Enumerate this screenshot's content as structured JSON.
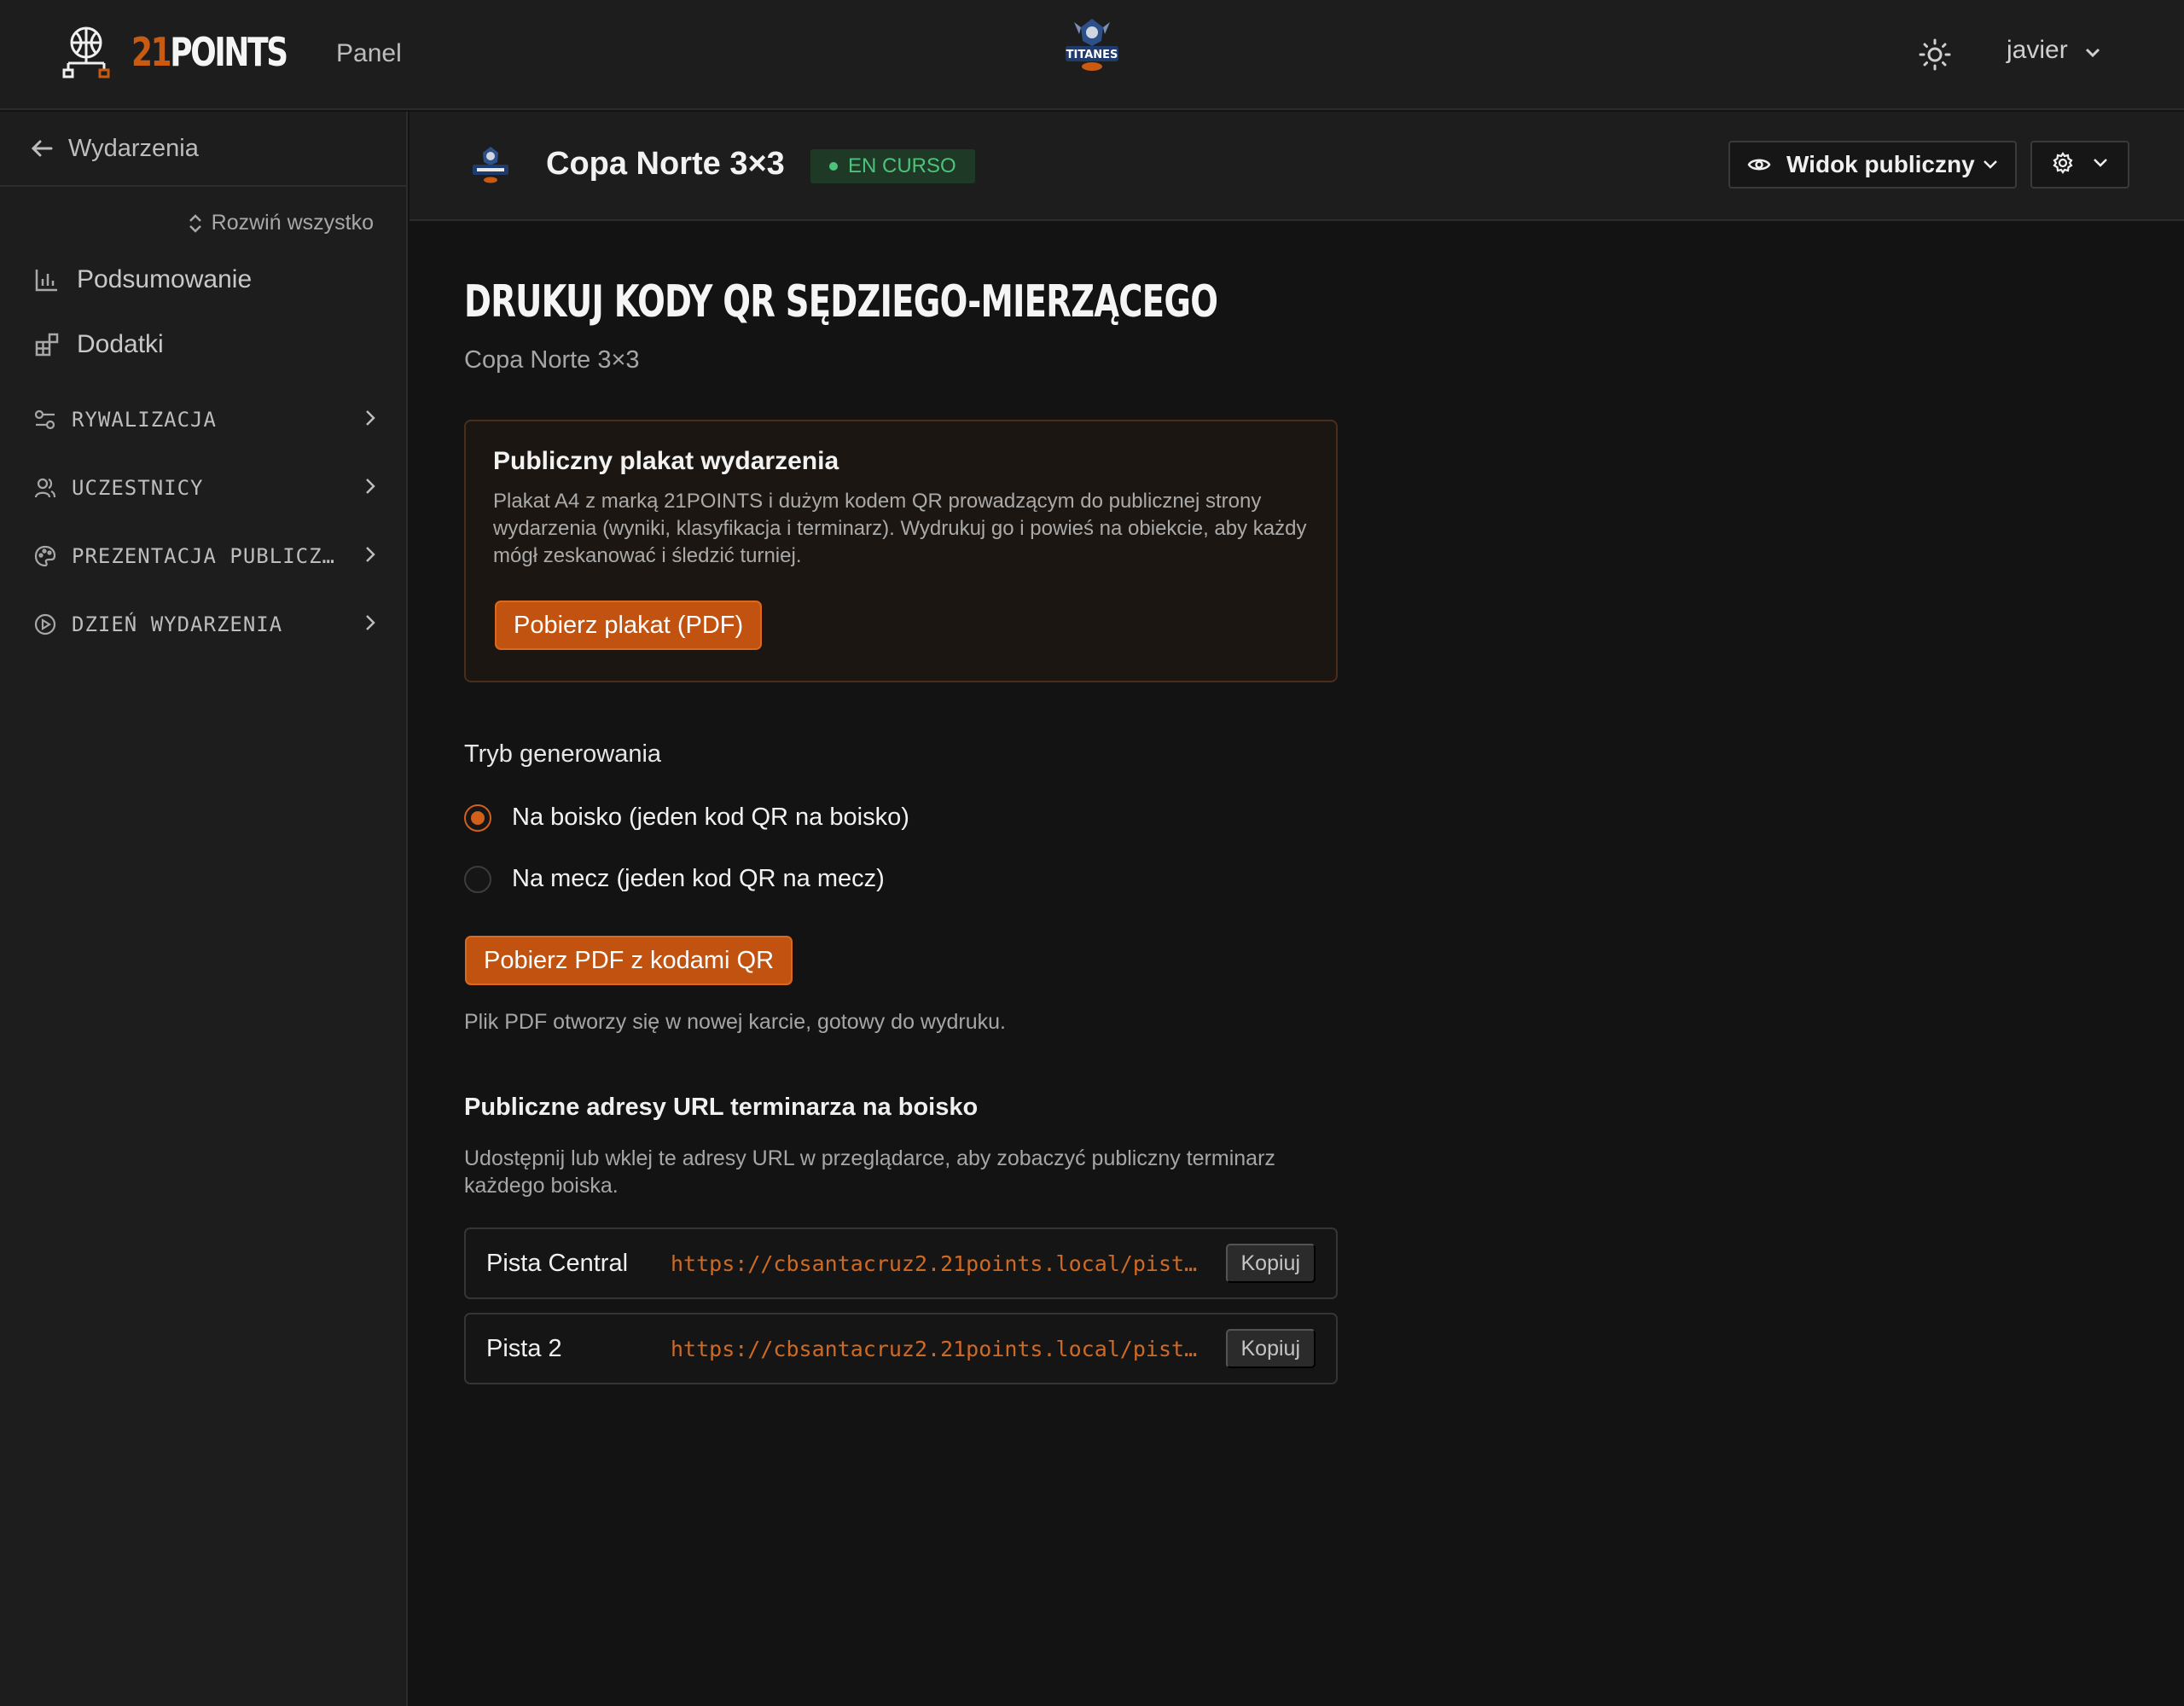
{
  "header": {
    "brand_number": "21",
    "brand_text": "POINTS",
    "nav_link": "Panel",
    "user_name": "javier",
    "team_logo_text": "TITANES"
  },
  "sidebar": {
    "back_label": "Wydarzenia",
    "expand_all": "Rozwiń wszystko",
    "items": [
      {
        "label": "Podsumowanie",
        "icon": "bar-chart-icon"
      },
      {
        "label": "Dodatki",
        "icon": "blocks-icon"
      }
    ],
    "groups": [
      {
        "label": "RYWALIZACJA",
        "icon": "sliders-icon"
      },
      {
        "label": "UCZESTNICY",
        "icon": "users-icon"
      },
      {
        "label": "PREZENTACJA PUBLICZ…",
        "icon": "palette-icon"
      },
      {
        "label": "DZIEŃ WYDARZENIA",
        "icon": "play-circle-icon"
      }
    ]
  },
  "event": {
    "title": "Copa Norte 3×3",
    "status": "EN CURSO",
    "public_view_label": "Widok publiczny"
  },
  "main": {
    "page_title": "DRUKUJ KODY QR SĘDZIEGO-MIERZĄCEGO",
    "subtitle": "Copa Norte 3×3",
    "poster": {
      "title": "Publiczny plakat wydarzenia",
      "description": "Plakat A4 z marką 21POINTS i dużym kodem QR prowadzącym do publicznej strony wydarzenia (wyniki, klasyfikacja i terminarz). Wydrukuj go i powieś na obiekcie, aby każdy mógł zeskanować i śledzić turniej.",
      "button": "Pobierz plakat (PDF)"
    },
    "mode_label": "Tryb generowania",
    "modes": [
      {
        "label": "Na boisko (jeden kod QR na boisko)",
        "checked": true
      },
      {
        "label": "Na mecz (jeden kod QR na mecz)",
        "checked": false
      }
    ],
    "download_button": "Pobierz PDF z kodami QR",
    "pdf_note": "Plik PDF otworzy się w nowej karcie, gotowy do wydruku.",
    "urls_title": "Publiczne adresy URL terminarza na boisko",
    "urls_description": "Udostępnij lub wklej te adresy URL w przeglądarce, aby zobaczyć publiczny terminarz każdego boiska.",
    "urls": [
      {
        "court": "Pista Central",
        "url": "https://cbsantacruz2.21points.local/pista/…",
        "copy": "Kopiuj"
      },
      {
        "court": "Pista 2",
        "url": "https://cbsantacruz2.21points.local/pista/…",
        "copy": "Kopiuj"
      }
    ]
  },
  "colors": {
    "accent": "#c2520f",
    "background": "#131313",
    "panel": "#1d1d1d",
    "status_green": "#4ec27a"
  }
}
